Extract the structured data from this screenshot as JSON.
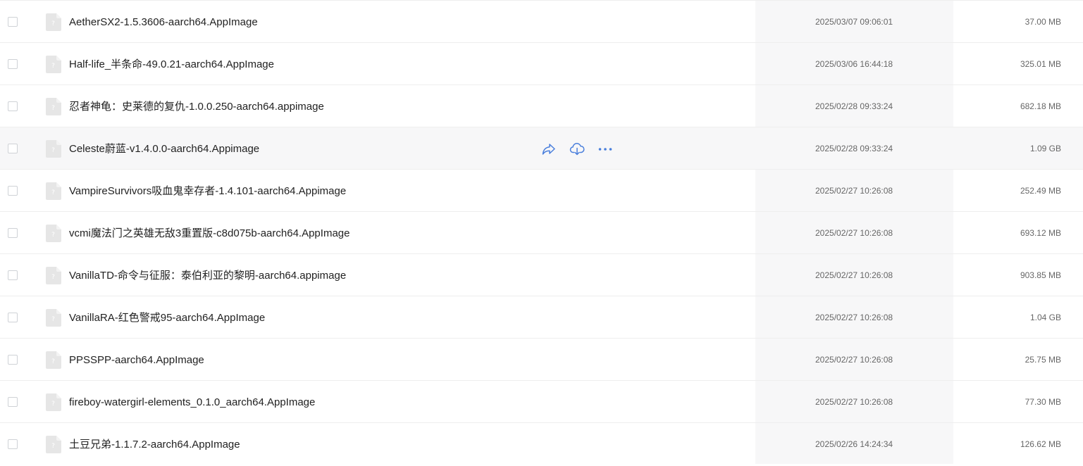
{
  "files": [
    {
      "name": "AetherSX2-1.5.3606-aarch64.AppImage",
      "modified": "2025/03/07 09:06:01",
      "size": "37.00 MB",
      "icon": "unknown-file-icon"
    },
    {
      "name": "Half-life_半条命-49.0.21-aarch64.AppImage",
      "modified": "2025/03/06 16:44:18",
      "size": "325.01 MB",
      "icon": "unknown-file-icon"
    },
    {
      "name": "忍者神龟：史莱德的复仇-1.0.0.250-aarch64.appimage",
      "modified": "2025/02/28 09:33:24",
      "size": "682.18 MB",
      "icon": "unknown-file-icon"
    },
    {
      "name": "Celeste蔚蓝-v1.4.0.0-aarch64.Appimage",
      "modified": "2025/02/28 09:33:24",
      "size": "1.09 GB",
      "icon": "unknown-file-icon"
    },
    {
      "name": "VampireSurvivors吸血鬼幸存者-1.4.101-aarch64.Appimage",
      "modified": "2025/02/27 10:26:08",
      "size": "252.49 MB",
      "icon": "unknown-file-icon"
    },
    {
      "name": "vcmi魔法门之英雄无敌3重置版-c8d075b-aarch64.AppImage",
      "modified": "2025/02/27 10:26:08",
      "size": "693.12 MB",
      "icon": "unknown-file-icon"
    },
    {
      "name": "VanillaTD-命令与征服：泰伯利亚的黎明-aarch64.appimage",
      "modified": "2025/02/27 10:26:08",
      "size": "903.85 MB",
      "icon": "unknown-file-icon"
    },
    {
      "name": "VanillaRA-红色警戒95-aarch64.AppImage",
      "modified": "2025/02/27 10:26:08",
      "size": "1.04 GB",
      "icon": "unknown-file-icon"
    },
    {
      "name": "PPSSPP-aarch64.AppImage",
      "modified": "2025/02/27 10:26:08",
      "size": "25.75 MB",
      "icon": "unknown-file-icon"
    },
    {
      "name": "fireboy-watergirl-elements_0.1.0_aarch64.AppImage",
      "modified": "2025/02/27 10:26:08",
      "size": "77.30 MB",
      "icon": "unknown-file-icon"
    },
    {
      "name": "土豆兄弟-1.1.7.2-aarch64.AppImage",
      "modified": "2025/02/26 14:24:34",
      "size": "126.62 MB",
      "icon": "unknown-file-icon"
    }
  ],
  "hovered_index": 3,
  "row_actions": [
    "share-icon",
    "download-icon",
    "more-icon"
  ],
  "colors": {
    "accent": "#4a7fdc",
    "row_border": "#eeeeee",
    "hover_bg": "#f7f7f8",
    "file_icon": "#e6e6e6",
    "text_primary": "#222222",
    "text_secondary": "#666666"
  }
}
